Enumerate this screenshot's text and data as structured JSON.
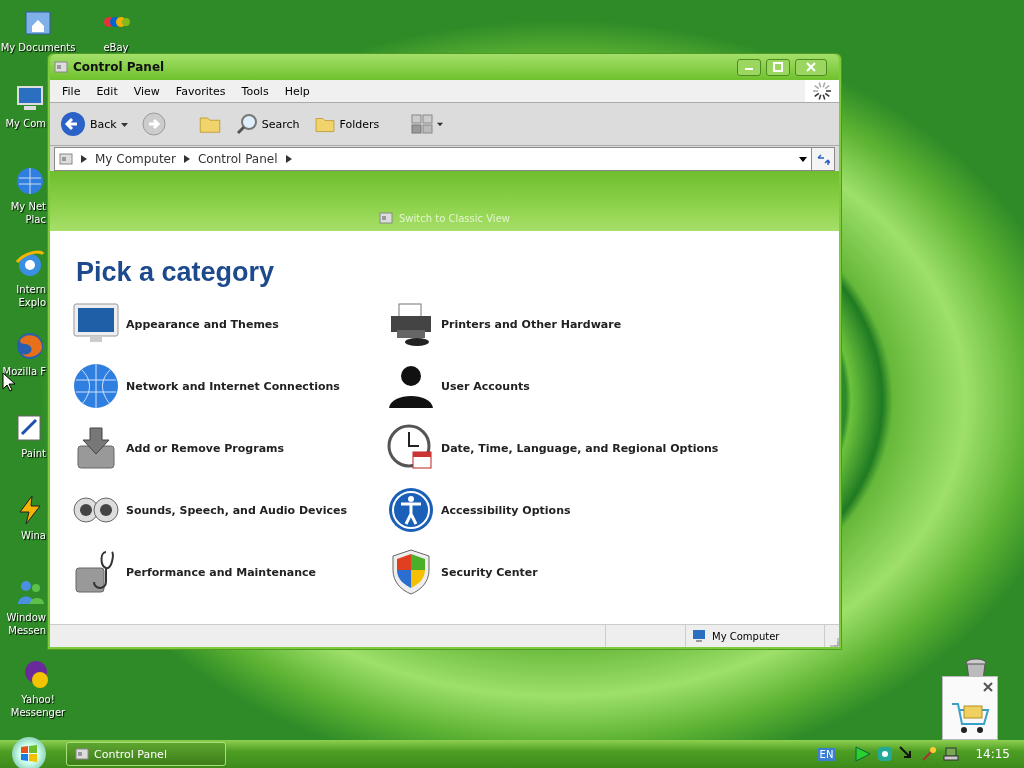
{
  "desktop_icons": [
    {
      "lines": [
        "My Documents"
      ]
    },
    {
      "lines": [
        "eBay"
      ]
    },
    {
      "lines": [
        "My Com"
      ]
    },
    {
      "lines": [
        "My Net",
        "Plac"
      ]
    },
    {
      "lines": [
        "Intern",
        "Explo"
      ]
    },
    {
      "lines": [
        "Mozilla F"
      ]
    },
    {
      "lines": [
        "Paint"
      ]
    },
    {
      "lines": [
        "Wina"
      ]
    },
    {
      "lines": [
        "Window",
        "Messen"
      ]
    },
    {
      "lines": [
        "Yahoo!",
        "Messenger"
      ]
    }
  ],
  "window": {
    "title": "Control Panel",
    "menu": [
      "File",
      "Edit",
      "View",
      "Favorites",
      "Tools",
      "Help"
    ],
    "toolbar": [
      {
        "kind": "back",
        "label": "Back"
      },
      {
        "kind": "forward"
      },
      {
        "kind": "up"
      },
      {
        "kind": "search",
        "label": "Search"
      },
      {
        "kind": "folders",
        "label": "Folders"
      },
      {
        "kind": "views"
      }
    ],
    "address": [
      "My Computer",
      "Control Panel"
    ],
    "switch_link": "Switch to Classic View",
    "heading": "Pick a category",
    "categories": [
      "Appearance and Themes",
      "Printers and Other Hardware",
      "Network and Internet Connections",
      "User Accounts",
      "Add or Remove Programs",
      "Date, Time, Language, and Regional Options",
      "Sounds, Speech, and Audio Devices",
      "Accessibility Options",
      "Performance and Maintenance",
      "Security Center"
    ],
    "status_bar": "My Computer"
  },
  "taskbar": {
    "tasks": [
      {
        "label": "Control Panel",
        "selected": true
      }
    ],
    "language": "EN",
    "clock": "14:15"
  }
}
